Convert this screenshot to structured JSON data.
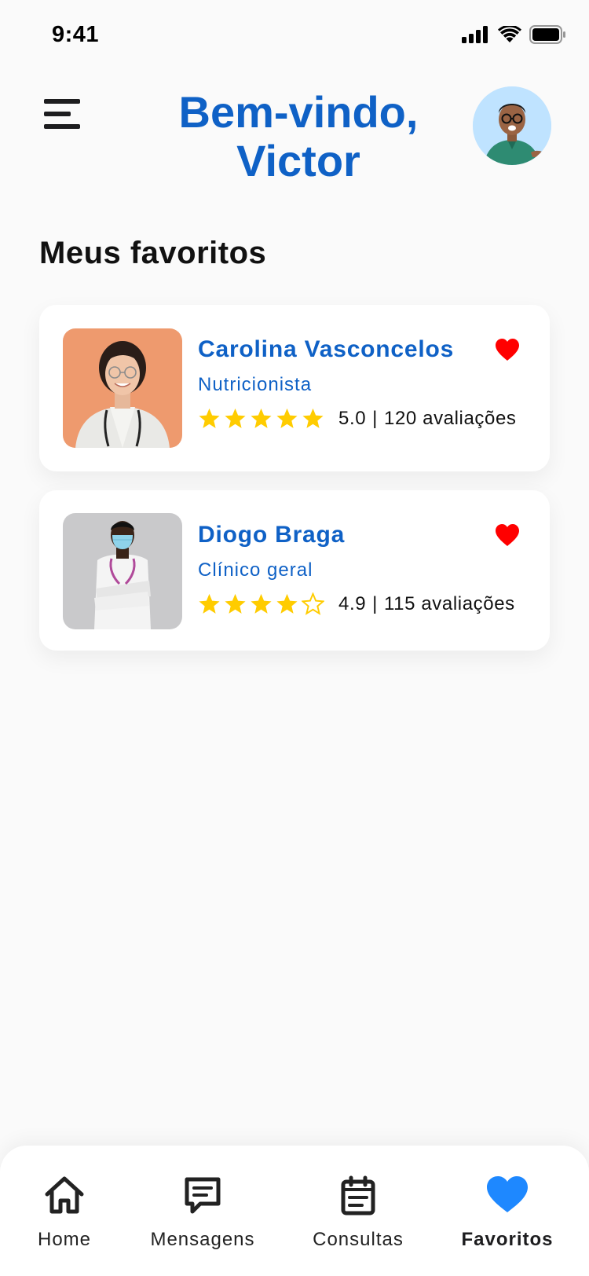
{
  "status_bar": {
    "time": "9:41",
    "icons": [
      "signal-icon",
      "wifi-icon",
      "battery-icon"
    ]
  },
  "header": {
    "greeting_line1": "Bem-vindo,",
    "greeting_line2": "Victor",
    "menu_icon": "hamburger-menu-icon",
    "avatar": "user-avatar"
  },
  "section_title": "Meus favoritos",
  "favorites": [
    {
      "name": "Carolina Vasconcelos",
      "role": "Nutricionista",
      "rating": "5.0",
      "separator": "|",
      "reviews": "120 avaliações",
      "stars_filled": 5,
      "photo_bg": "#ee9a6e"
    },
    {
      "name": "Diogo Braga",
      "role": "Clínico geral",
      "rating": "4.9",
      "separator": "|",
      "reviews": "115 avaliações",
      "stars_filled": 4,
      "photo_bg": "#c9c9cb"
    }
  ],
  "bottom_nav": {
    "items": [
      {
        "label": "Home",
        "icon": "home-icon",
        "active": false
      },
      {
        "label": "Mensagens",
        "icon": "message-icon",
        "active": false
      },
      {
        "label": "Consultas",
        "icon": "calendar-icon",
        "active": false
      },
      {
        "label": "Favoritos",
        "icon": "heart-icon",
        "active": true
      }
    ]
  },
  "colors": {
    "primary": "#0f61c6",
    "heart_red": "#ff0000",
    "star_yellow": "#ffcc00",
    "nav_active": "#1e88ff",
    "background": "#fafafa"
  }
}
